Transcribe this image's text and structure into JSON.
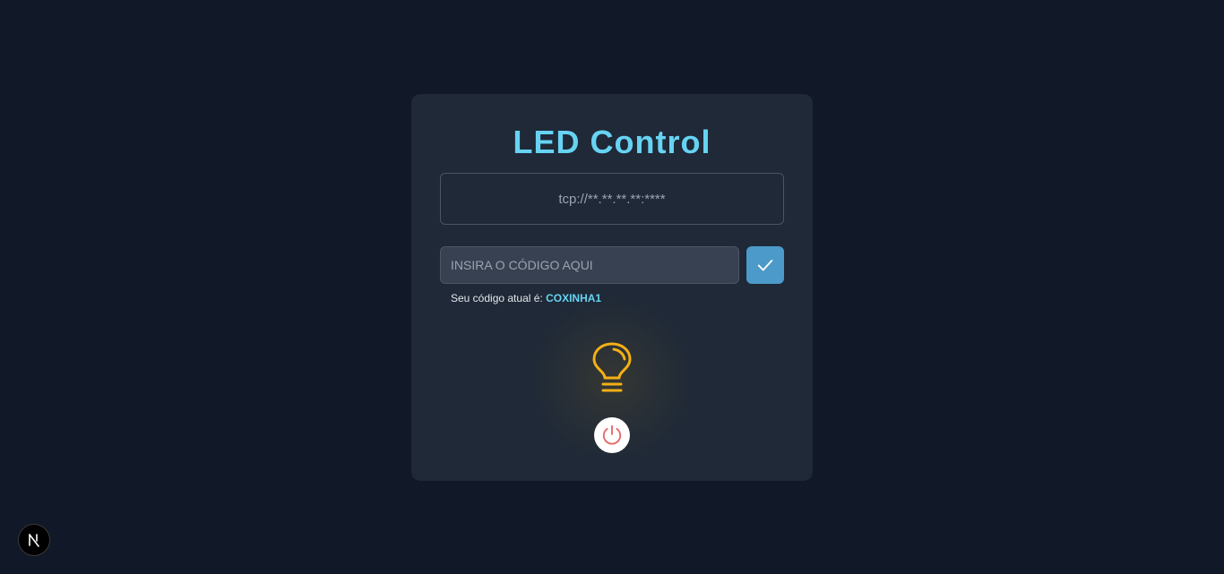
{
  "app": {
    "title": "LED Control"
  },
  "address": {
    "value": "tcp://**.**.**.**:****"
  },
  "code_form": {
    "placeholder": "INSIRA O CÓDIGO AQUI",
    "submit_icon": "check-icon"
  },
  "current_code": {
    "label": "Seu código atual é:",
    "value": "COXINHA1"
  },
  "led": {
    "icon": "lightbulb-icon",
    "state_color": "#f5b014"
  },
  "power": {
    "icon": "power-icon",
    "color": "#e76f6f"
  },
  "badge": {
    "letter": "N"
  },
  "colors": {
    "accent": "#67d3f3",
    "button": "#4c9ac9",
    "background": "#111827",
    "card": "#1f2937"
  }
}
